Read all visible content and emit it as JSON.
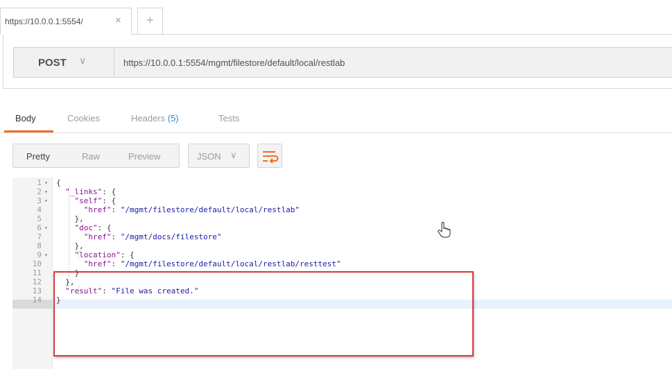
{
  "tab": {
    "label": "https://10.0.0.1:5554/",
    "close": "×",
    "new": "+"
  },
  "request": {
    "method": "POST",
    "method_chevron": "∨",
    "url": "https://10.0.0.1:5554/mgmt/filestore/default/local/restlab"
  },
  "response_tabs": [
    {
      "label": "Body"
    },
    {
      "label": "Cookies"
    },
    {
      "label": "Headers ",
      "count": "(5)"
    },
    {
      "label": "Tests"
    }
  ],
  "view_modes": [
    "Pretty",
    "Raw",
    "Preview"
  ],
  "format": {
    "label": "JSON",
    "chevron": "∨"
  },
  "code_lines": [
    {
      "num": "1",
      "fold": "▾",
      "parts": [
        [
          "p",
          "{"
        ]
      ]
    },
    {
      "num": "2",
      "fold": "▾",
      "parts": [
        [
          "p",
          "  "
        ],
        [
          "k",
          "\"_links\""
        ],
        [
          "p",
          ": {"
        ]
      ]
    },
    {
      "num": "3",
      "fold": "▾",
      "parts": [
        [
          "p",
          "    "
        ],
        [
          "k",
          "\"self\""
        ],
        [
          "p",
          ": {"
        ]
      ]
    },
    {
      "num": "4",
      "fold": "",
      "parts": [
        [
          "p",
          "      "
        ],
        [
          "k",
          "\"href\""
        ],
        [
          "p",
          ": "
        ],
        [
          "s",
          "\"/mgmt/filestore/default/local/restlab\""
        ]
      ]
    },
    {
      "num": "5",
      "fold": "",
      "parts": [
        [
          "p",
          "    },"
        ]
      ]
    },
    {
      "num": "6",
      "fold": "▾",
      "parts": [
        [
          "p",
          "    "
        ],
        [
          "k",
          "\"doc\""
        ],
        [
          "p",
          ": {"
        ]
      ]
    },
    {
      "num": "7",
      "fold": "",
      "parts": [
        [
          "p",
          "      "
        ],
        [
          "k",
          "\"href\""
        ],
        [
          "p",
          ": "
        ],
        [
          "s",
          "\"/mgmt/docs/filestore\""
        ]
      ]
    },
    {
      "num": "8",
      "fold": "",
      "parts": [
        [
          "p",
          "    },"
        ]
      ]
    },
    {
      "num": "9",
      "fold": "▾",
      "parts": [
        [
          "p",
          "    "
        ],
        [
          "k",
          "\"location\""
        ],
        [
          "p",
          ": {"
        ]
      ]
    },
    {
      "num": "10",
      "fold": "",
      "parts": [
        [
          "p",
          "      "
        ],
        [
          "k",
          "\"href\""
        ],
        [
          "p",
          ": "
        ],
        [
          "s",
          "\"/mgmt/filestore/default/local/restlab/resttest\""
        ]
      ]
    },
    {
      "num": "11",
      "fold": "",
      "parts": [
        [
          "p",
          "    }"
        ]
      ]
    },
    {
      "num": "12",
      "fold": "",
      "parts": [
        [
          "p",
          "  },"
        ]
      ]
    },
    {
      "num": "13",
      "fold": "",
      "parts": [
        [
          "p",
          "  "
        ],
        [
          "k",
          "\"result\""
        ],
        [
          "p",
          ": "
        ],
        [
          "s",
          "\"File was created.\""
        ]
      ]
    },
    {
      "num": "14",
      "fold": "",
      "parts": [
        [
          "p",
          "}"
        ]
      ]
    }
  ],
  "colors": {
    "accent": "#f16b22",
    "highlight_border": "#d9363a",
    "count_blue": "#2b87d1",
    "key": "#881391",
    "string": "#1a1aa6"
  },
  "icons": {
    "wrap": "wrap-lines-icon",
    "cursor": "hand-pointer-icon"
  }
}
